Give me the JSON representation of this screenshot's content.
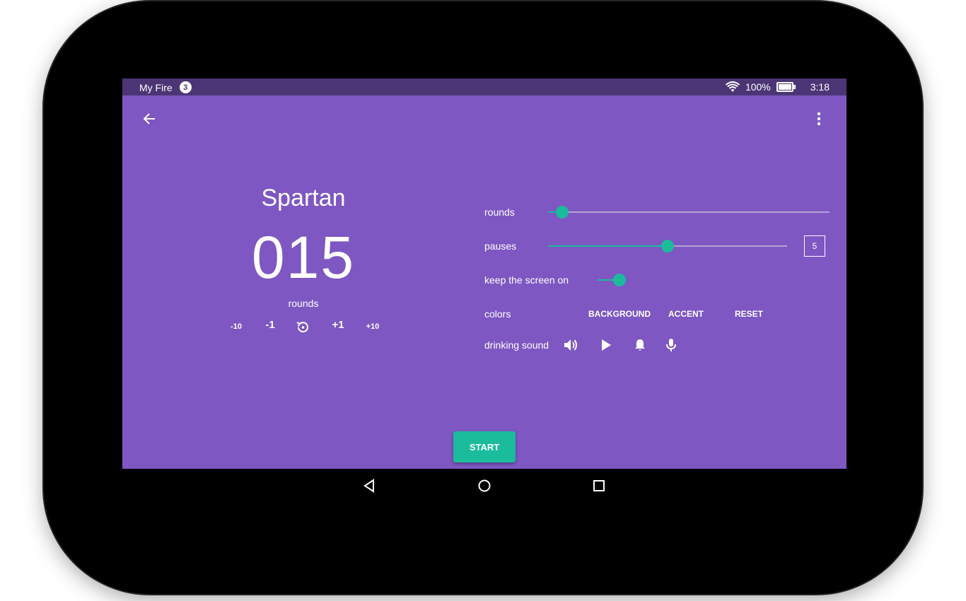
{
  "statusbar": {
    "app_name": "My Fire",
    "notification_count": "3",
    "battery": "100%",
    "battery_level": 1.0,
    "time": "3:18"
  },
  "appbar": {
    "back_icon": "arrow-back-icon",
    "menu_icon": "more-vert-icon"
  },
  "counter": {
    "title": "Spartan",
    "value": "015",
    "label": "rounds",
    "steps": [
      "-10",
      "-1",
      "+1",
      "+10"
    ],
    "reset_icon": "reset-icon"
  },
  "settings": {
    "rounds_label": "rounds",
    "rounds_level": 0.05,
    "pauses_label": "pauses",
    "pauses_level": 0.5,
    "pauses_value": "5",
    "keep_screen_label": "keep the screen on",
    "keep_screen_on": true,
    "colors_label": "colors",
    "color_buttons": [
      "BACKGROUND",
      "ACCENT",
      "RESET"
    ],
    "drinking_sound_label": "drinking sound",
    "sound_icons": [
      "volume-icon",
      "play-icon",
      "bell-icon",
      "mic-icon"
    ]
  },
  "start_button": "START",
  "navbar": {
    "icons": [
      "back-triangle-icon",
      "home-circle-icon",
      "recents-square-icon"
    ]
  },
  "colors": {
    "background": "#7e57c2",
    "statusbar": "#4c3575",
    "accent": "#1abc9c"
  }
}
